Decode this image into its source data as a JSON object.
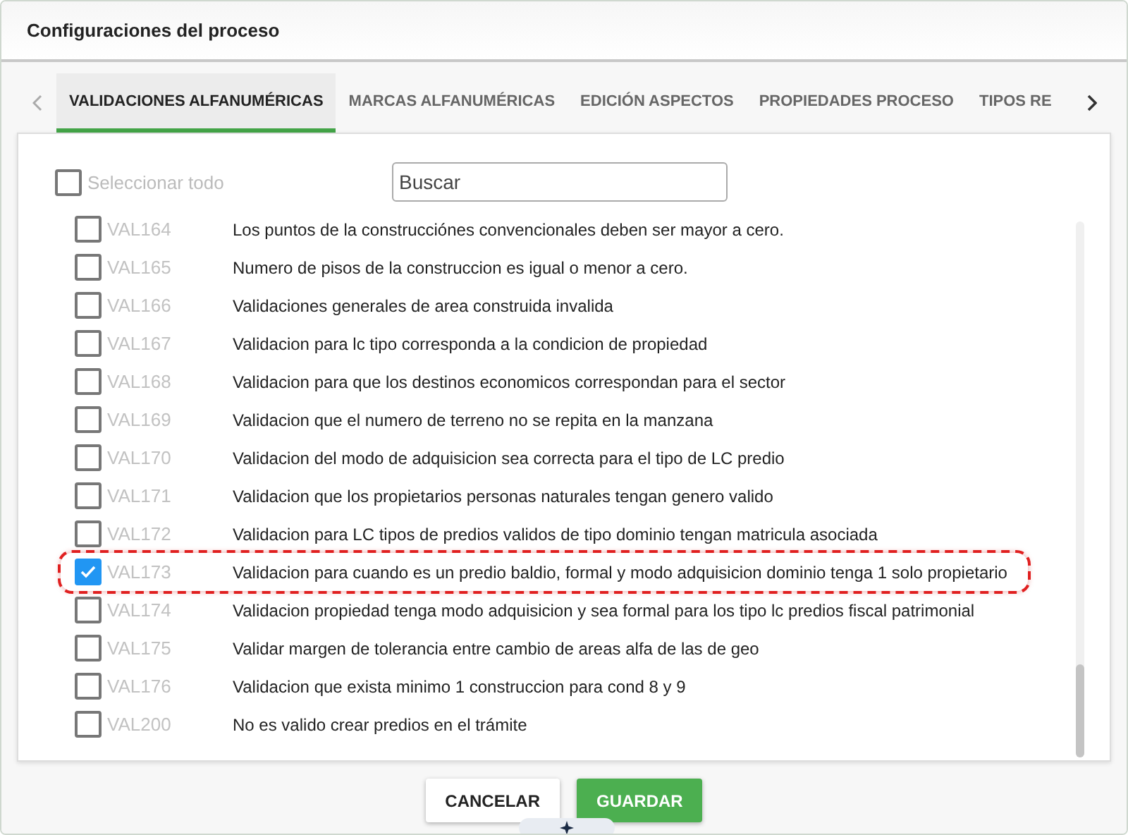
{
  "window": {
    "title": "Configuraciones del proceso"
  },
  "tabs": [
    {
      "label": "VALIDACIONES ALFANUMÉRICAS",
      "selected": true
    },
    {
      "label": "MARCAS ALFANUMÉRICAS",
      "selected": false
    },
    {
      "label": "EDICIÓN ASPECTOS",
      "selected": false
    },
    {
      "label": "PROPIEDADES PROCESO",
      "selected": false
    },
    {
      "label": "TIPOS RE",
      "selected": false
    }
  ],
  "select_all": {
    "label": "Seleccionar todo",
    "checked": false
  },
  "search": {
    "placeholder": "Buscar"
  },
  "rows": [
    {
      "code": "VAL164",
      "description": "Los puntos de la construcciónes convencionales deben ser mayor a cero.",
      "checked": false,
      "highlighted": false
    },
    {
      "code": "VAL165",
      "description": "Numero de pisos de la construccion es igual o menor a cero.",
      "checked": false,
      "highlighted": false
    },
    {
      "code": "VAL166",
      "description": "Validaciones generales de area construida invalida",
      "checked": false,
      "highlighted": false
    },
    {
      "code": "VAL167",
      "description": "Validacion para lc tipo corresponda a la condicion de propiedad",
      "checked": false,
      "highlighted": false
    },
    {
      "code": "VAL168",
      "description": "Validacion para que los destinos economicos correspondan para el sector",
      "checked": false,
      "highlighted": false
    },
    {
      "code": "VAL169",
      "description": "Validacion que el numero de terreno no se repita en la manzana",
      "checked": false,
      "highlighted": false
    },
    {
      "code": "VAL170",
      "description": "Validacion del modo de adquisicion sea correcta para el tipo de LC predio",
      "checked": false,
      "highlighted": false
    },
    {
      "code": "VAL171",
      "description": "Validacion que los propietarios personas naturales tengan genero valido",
      "checked": false,
      "highlighted": false
    },
    {
      "code": "VAL172",
      "description": "Validacion para LC tipos de predios validos de tipo dominio tengan matricula asociada",
      "checked": false,
      "highlighted": false
    },
    {
      "code": "VAL173",
      "description": "Validacion para cuando es un predio baldio, formal y modo adquisicion dominio tenga 1 solo propietario",
      "checked": true,
      "highlighted": true
    },
    {
      "code": "VAL174",
      "description": "Validacion propiedad tenga modo adquisicion y sea formal para los tipo lc predios fiscal patrimonial",
      "checked": false,
      "highlighted": false
    },
    {
      "code": "VAL175",
      "description": "Validar margen de tolerancia entre cambio de areas alfa de las de geo",
      "checked": false,
      "highlighted": false
    },
    {
      "code": "VAL176",
      "description": "Validacion que exista minimo 1 construccion para cond 8 y 9",
      "checked": false,
      "highlighted": false
    },
    {
      "code": "VAL200",
      "description": "No es valido crear predios en el trámite",
      "checked": false,
      "highlighted": false
    }
  ],
  "buttons": [
    {
      "label": "CANCELAR",
      "kind": "secondary"
    },
    {
      "label": "GUARDAR",
      "kind": "primary"
    }
  ]
}
